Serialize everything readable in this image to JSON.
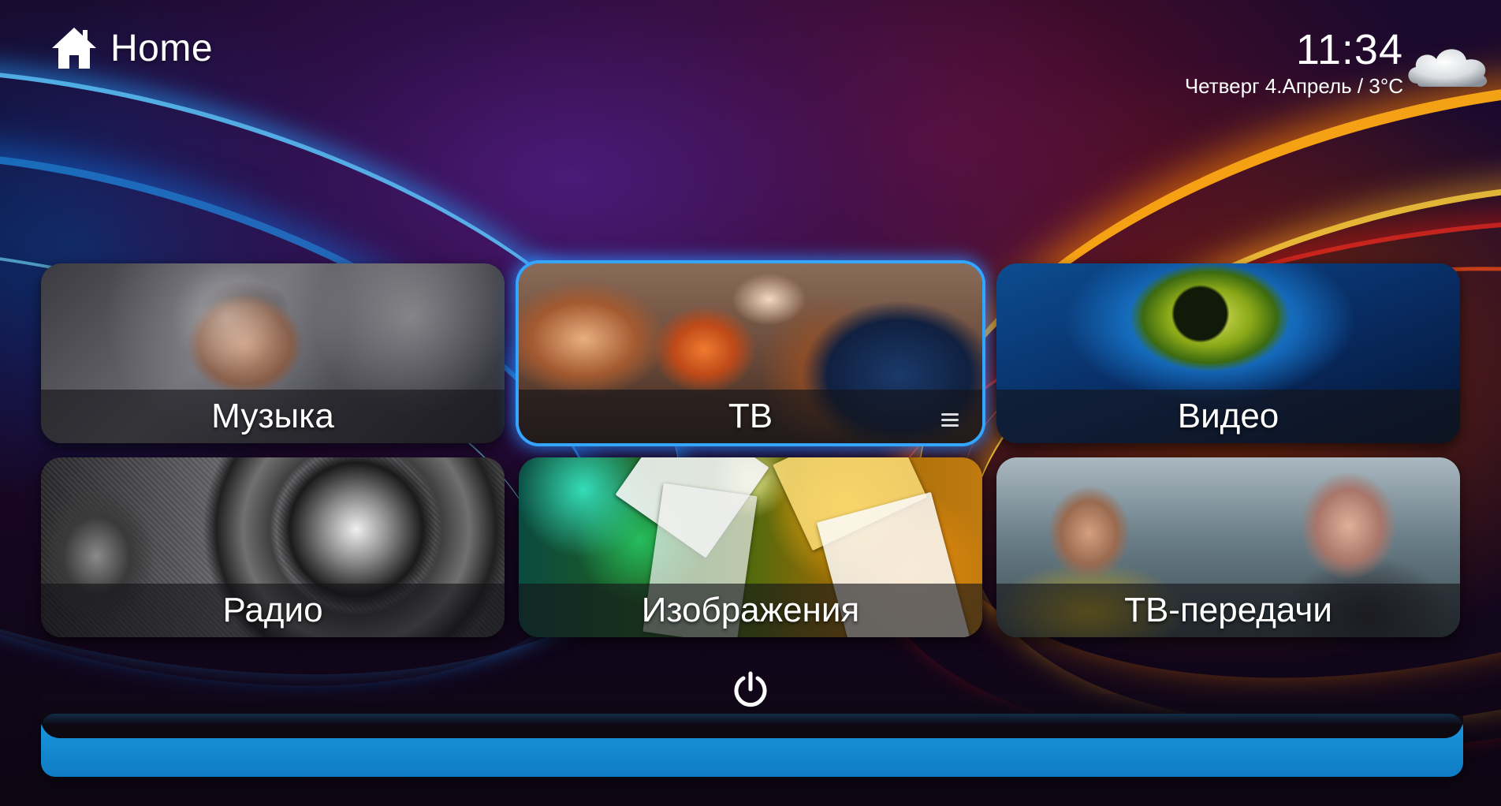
{
  "header": {
    "title": "Home",
    "home_icon": "home-icon",
    "clock": "11:34",
    "date_weather": "Четверг 4.Апрель / 3°C",
    "weather_icon": "cloud-icon"
  },
  "tiles": [
    {
      "label": "Музыка",
      "art": "woman-with-music-notes"
    },
    {
      "label": "ТВ",
      "art": "cartoon-family-watching-tv",
      "selected": true
    },
    {
      "label": "Видео",
      "art": "avatar-eye"
    },
    {
      "label": "Радио",
      "art": "speaker-closeup"
    },
    {
      "label": "Изображения",
      "art": "colorful-photo-frames"
    },
    {
      "label": "ТВ-передачи",
      "art": "two-men-in-car"
    }
  ],
  "footer": {
    "power_icon": "power-icon"
  },
  "colors": {
    "selection_glow": "#35a6ff",
    "dock": "#1a9ae0"
  }
}
